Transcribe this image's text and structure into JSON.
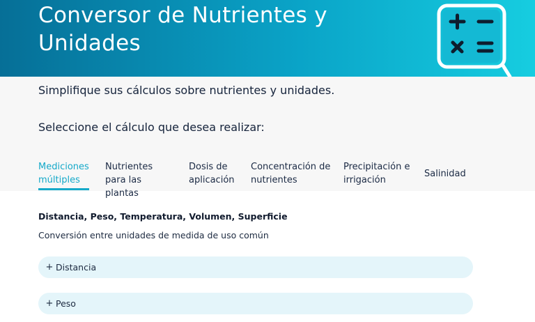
{
  "header": {
    "title": "Conversor de Nutrientes y Unidades",
    "icon": "calculator-icon"
  },
  "intro": {
    "subtitle": "Simplifique sus cálculos sobre nutrientes y unidades.",
    "prompt": "Seleccione el cálculo que desea realizar:"
  },
  "tabs": [
    {
      "label": "Mediciones múltiples",
      "active": true
    },
    {
      "label": "Nutrientes para las plantas",
      "active": false
    },
    {
      "label": "Dosis de aplicación",
      "active": false
    },
    {
      "label": "Concentración de nutrientes",
      "active": false
    },
    {
      "label": "Precipitación e irrigación",
      "active": false
    },
    {
      "label": "Salinidad",
      "active": false
    }
  ],
  "section": {
    "title": "Distancia, Peso, Temperatura, Volumen, Superficie",
    "description": "Conversión entre unidades de medida de uso común"
  },
  "accordions": [
    {
      "icon": "+",
      "label": "Distancia"
    },
    {
      "icon": "+",
      "label": "Peso"
    }
  ],
  "colors": {
    "accent": "#15a9c9",
    "header_start": "#066f97",
    "header_end": "#16cde0",
    "accordion_bg": "#e4f5fa"
  }
}
